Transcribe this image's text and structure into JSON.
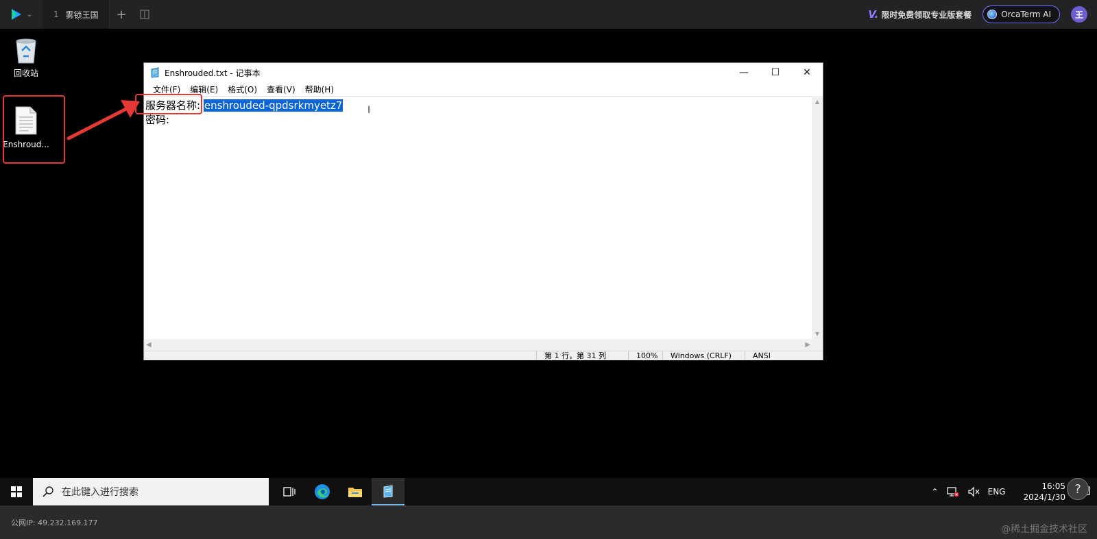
{
  "app": {
    "tab_index": "1",
    "tab_title": "雾锁王国",
    "promo_text": "限时免费领取专业版套餐",
    "ai_button": "OrcaTerm AI",
    "avatar_letter": "王"
  },
  "desktop": {
    "icons": [
      {
        "label": "回收站",
        "icon": "recycle-bin-icon"
      },
      {
        "label": "Enshroud...",
        "icon": "text-file-icon"
      }
    ]
  },
  "notepad": {
    "title": "Enshrouded.txt - 记事本",
    "menu": [
      "文件(F)",
      "编辑(E)",
      "格式(O)",
      "查看(V)",
      "帮助(H)"
    ],
    "line1_label": "服务器名称:",
    "line1_value": "enshrouded-qpdsrkmyetz7",
    "line2_label": "密码:",
    "status": {
      "position": "第 1 行，第 31 列",
      "zoom": "100%",
      "line_ending": "Windows (CRLF)",
      "encoding": "ANSI"
    }
  },
  "taskbar": {
    "search_placeholder": "在此键入进行搜索",
    "language": "ENG",
    "time": "16:05",
    "date": "2024/1/30"
  },
  "footer": {
    "ip_text": "公网IP: 49.232.169.177",
    "watermark": "@稀土掘金技术社区",
    "help_label": "?"
  },
  "colors": {
    "selection": "#0a64d6",
    "highlight_red": "#e53935",
    "accent_purple": "#6e74ff"
  }
}
